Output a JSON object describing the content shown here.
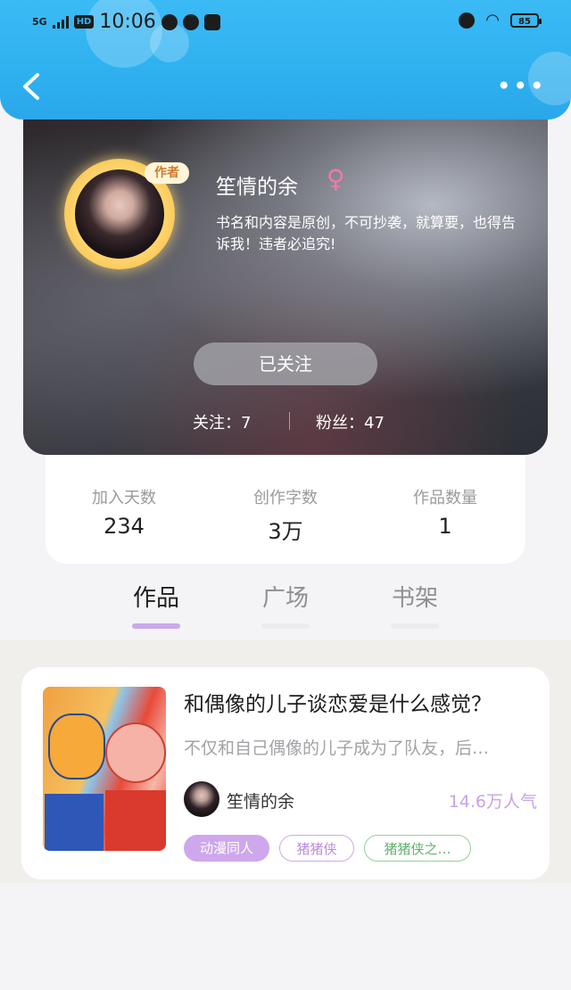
{
  "status_bar": {
    "network": "5G",
    "hd": "HD",
    "time": "10:06",
    "battery": "85"
  },
  "nav": {
    "back_icon": "chevron-left-icon",
    "more_icon": "more-dots-icon",
    "more_label": "•••"
  },
  "profile": {
    "avatar_badge": "作者",
    "name": "笙情的余",
    "gender_symbol": "♀",
    "bio": "书名和内容是原创，不可抄袭，就算要，也得告诉我！违者必追究!",
    "follow_button": "已关注",
    "following": "关注：7",
    "fans": "粉丝：47"
  },
  "stats": [
    {
      "label": "加入天数",
      "value": "234"
    },
    {
      "label": "创作字数",
      "value": "3万"
    },
    {
      "label": "作品数量",
      "value": "1"
    }
  ],
  "tabs": [
    {
      "label": "作品",
      "active": true
    },
    {
      "label": "广场",
      "active": false
    },
    {
      "label": "书架",
      "active": false
    }
  ],
  "works": [
    {
      "title": "和偶像的儿子谈恋爱是什么感觉？",
      "description": "不仅和自己偶像的儿子成为了队友，后…",
      "author": "笙情的余",
      "popularity": "14.6万人气",
      "tags": [
        "动漫同人",
        "猪猪侠",
        "猪猪侠之…"
      ]
    }
  ],
  "colors": {
    "accent_blue": "#2fb1ef",
    "accent_purple": "#c9a8ea",
    "tag_green": "#5fb36d",
    "gender_pink": "#f07aa8"
  }
}
